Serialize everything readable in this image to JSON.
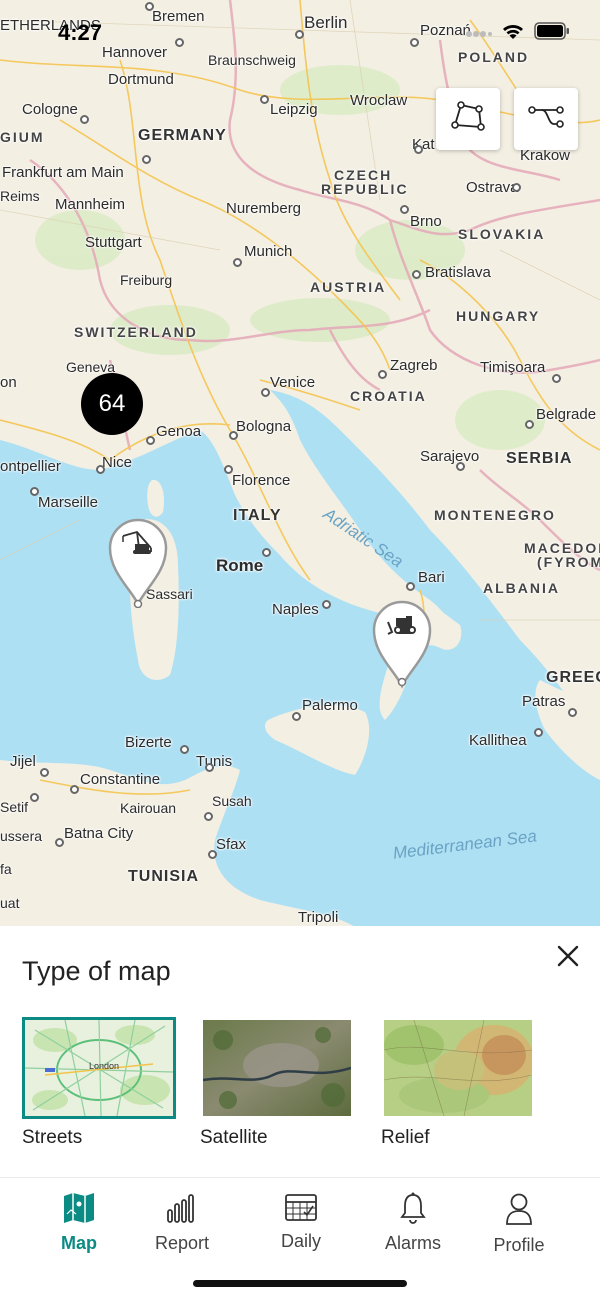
{
  "status": {
    "time": "4:27"
  },
  "map": {
    "cluster_count": "64",
    "labels": {
      "netherlands": "ETHERLANDS",
      "bremen": "Bremen",
      "berlin": "Berlin",
      "poznan": "Poznań",
      "poland": "POLAND",
      "hannover": "Hannover",
      "braunschweig": "Braunschweig",
      "dortmund": "Dortmund",
      "germany": "GERMANY",
      "wroclaw": "Wroclaw",
      "cologne": "Cologne",
      "belgium": "GIUM",
      "leipzig": "Leipzig",
      "katowice": "Kat",
      "krakow": "Krakow",
      "frankfurt": "Frankfurt am Main",
      "reims": "Reims",
      "czech": "CZECH",
      "republic": "REPUBLIC",
      "ostrava": "Ostrava",
      "mannheim": "Mannheim",
      "nuremberg": "Nuremberg",
      "brno": "Brno",
      "stuttgart": "Stuttgart",
      "slovakia": "SLOVAKIA",
      "munich": "Munich",
      "bratislava": "Bratislava",
      "freiburg": "Freiburg",
      "austria": "AUSTRIA",
      "hungary": "HUNGARY",
      "switzerland": "SWITZERLAND",
      "geneva": "Geneva",
      "zagreb": "Zagreb",
      "timisoara": "Timişoara",
      "venice": "Venice",
      "croatia": "CROATIA",
      "lyon": "on",
      "belgrade": "Belgrade",
      "genoa": "Genoa",
      "bologna": "Bologna",
      "montpellier": "ontpellier",
      "nice": "Nice",
      "sarajevo": "Sarajevo",
      "serbia": "SERBIA",
      "florence": "Florence",
      "marseille": "Marseille",
      "adriatic": "Adriatic Sea",
      "italy": "ITALY",
      "montenegro": "MONTENEGRO",
      "macedonia": "MACEDON",
      "fyrom": "(FYROM",
      "rome": "Rome",
      "bari": "Bari",
      "sassari": "Sassari",
      "albania": "ALBANIA",
      "naples": "Naples",
      "greece": "GREEC",
      "palermo": "Palermo",
      "patras": "Patras",
      "bizerte": "Bizerte",
      "kallithea": "Kallithea",
      "jijel": "Jijel",
      "tunis": "Tunis",
      "constantine": "Constantine",
      "susah": "Susah",
      "setif": "Setif",
      "kairouan": "Kairouan",
      "mediterranean": "Mediterranean Sea",
      "biskra": "ussera",
      "batna": "Batna City",
      "sfax": "Sfax",
      "afa": "fa",
      "tunisia": "TUNISIA",
      "ouat": "uat",
      "tripoli": "Tripoli"
    },
    "pins": [
      {
        "name": "crane-pin",
        "icon": "crane-icon"
      },
      {
        "name": "bulldozer-pin",
        "icon": "bulldozer-icon"
      }
    ],
    "tools": [
      {
        "name": "polygon-tool",
        "icon": "polygon-icon"
      },
      {
        "name": "route-tool",
        "icon": "route-icon"
      }
    ]
  },
  "sheet": {
    "title": "Type of map",
    "options": [
      {
        "label": "Streets",
        "selected": true,
        "thumb_label": "London"
      },
      {
        "label": "Satellite",
        "selected": false
      },
      {
        "label": "Relief",
        "selected": false
      }
    ]
  },
  "tabs": [
    {
      "label": "Map",
      "icon": "map-icon",
      "active": true
    },
    {
      "label": "Report",
      "icon": "bar-chart-icon",
      "active": false
    },
    {
      "label": "Daily",
      "icon": "calendar-icon",
      "active": false
    },
    {
      "label": "Alarms",
      "icon": "bell-icon",
      "active": false
    },
    {
      "label": "Profile",
      "icon": "user-icon",
      "active": false
    }
  ],
  "colors": {
    "accent": "#0c8a84",
    "sea": "#aee0f4",
    "land": "#f3efe3"
  }
}
